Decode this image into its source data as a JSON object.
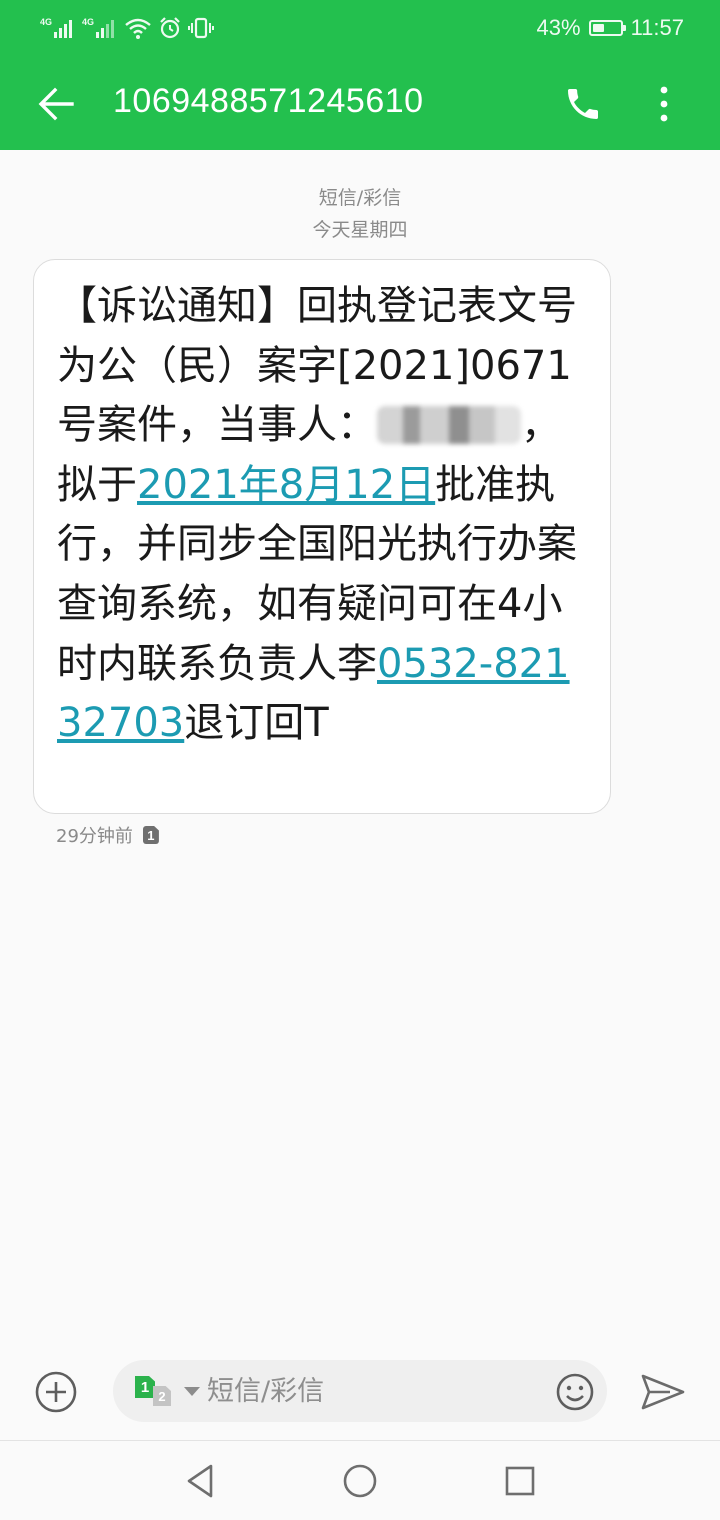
{
  "status_bar": {
    "network_1": "4G",
    "network_2": "4G",
    "battery_percent": "43%",
    "battery_level": 0.43,
    "time": "11:57"
  },
  "app_bar": {
    "title": "1069488571245610",
    "icons": {
      "back": "back-arrow-icon",
      "call": "phone-icon",
      "more": "more-vertical-icon"
    }
  },
  "thread": {
    "channel_label": "短信/彩信",
    "day_label": "今天星期四"
  },
  "message": {
    "parts": {
      "p1": "【诉讼通知】回执登记表文号为公（民）案字[2021]0671号案件，当事人：",
      "p2": "，拟于",
      "date_link": "2021年8月12日",
      "p3": "批准执行，并同步全国阳光执行办案查询系统，如有疑问可在4小时内联系负责人李",
      "phone_link": "0532-82132703",
      "p4": "退订回T"
    },
    "time_ago": "29分钟前",
    "sim_badge": "1",
    "colors": {
      "link": "#1c9bb2"
    }
  },
  "composer": {
    "placeholder": "短信/彩信",
    "value": "",
    "sim_primary": "1",
    "sim_secondary": "2",
    "icons": {
      "add": "plus-circle-icon",
      "emoji": "smiley-icon",
      "send": "send-icon"
    }
  },
  "nav_bar": {
    "icons": [
      "back-triangle-icon",
      "home-circle-icon",
      "recents-square-icon"
    ]
  },
  "colors": {
    "accent": "#23c04e",
    "background": "#fafafa"
  }
}
